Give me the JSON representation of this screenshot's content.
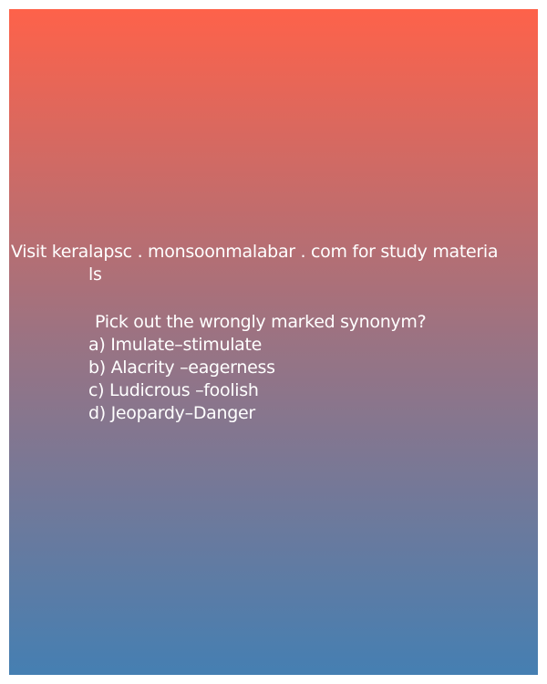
{
  "promo": {
    "line1": "Visit keralapsc . monsoonmalabar . com for study materia",
    "line2": "ls"
  },
  "question": {
    "prompt": "Pick out the wrongly marked synonym?",
    "options": [
      "a) Imulate–stimulate",
      "b) Alacrity –eagerness",
      "c) Ludicrous –foolish",
      "d) Jeopardy–Danger"
    ]
  },
  "colors": {
    "gradient_top": "#fe624a",
    "gradient_mid": "#9a7383",
    "gradient_bottom": "#457fb2",
    "text": "#ffffff"
  }
}
